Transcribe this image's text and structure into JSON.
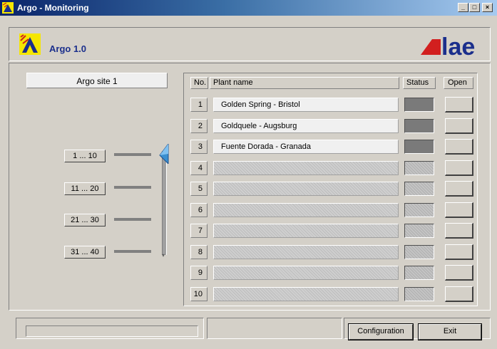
{
  "window": {
    "title": "Argo - Monitoring",
    "buttons": {
      "minimize": "_",
      "maximize": "□",
      "close": "×"
    }
  },
  "header": {
    "version": "Argo 1.0",
    "brand": "lae"
  },
  "site": {
    "label": "Argo site 1"
  },
  "ranges": [
    "1 ... 10",
    "11 ... 20",
    "21 ... 30",
    "31 ... 40"
  ],
  "table": {
    "headers": {
      "no": "No.",
      "name": "Plant name",
      "status": "Status",
      "open": "Open"
    },
    "rows": [
      {
        "no": "1",
        "name": "Golden Spring - Bristol"
      },
      {
        "no": "2",
        "name": "Goldquele - Augsburg"
      },
      {
        "no": "3",
        "name": "Fuente Dorada - Granada"
      },
      {
        "no": "4",
        "name": ""
      },
      {
        "no": "5",
        "name": ""
      },
      {
        "no": "6",
        "name": ""
      },
      {
        "no": "7",
        "name": ""
      },
      {
        "no": "8",
        "name": ""
      },
      {
        "no": "9",
        "name": ""
      },
      {
        "no": "10",
        "name": ""
      }
    ]
  },
  "footer": {
    "configuration": "Configuration",
    "exit": "Exit"
  },
  "colors": {
    "titlebar": "#0a246a",
    "accent": "#1b2f8c",
    "brand_red": "#d21f1f",
    "brand_blue": "#1b2f8c"
  }
}
